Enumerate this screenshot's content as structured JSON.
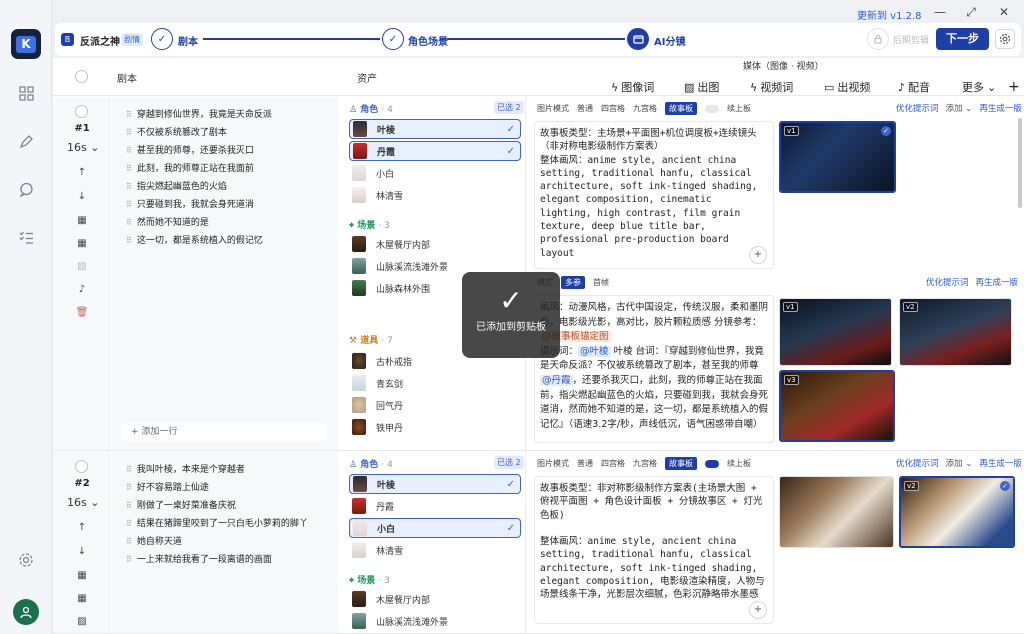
{
  "window": {
    "update_text": "更新到 v1.2.8"
  },
  "project": {
    "icon": "B",
    "name": "反派之神",
    "badge": "剧情"
  },
  "steps": [
    {
      "label": "剧本"
    },
    {
      "label": "角色场景"
    },
    {
      "label": "AI分镜"
    }
  ],
  "toolbar": {
    "post_edit": "后期剪辑",
    "next": "下一步"
  },
  "table": {
    "col_script": "剧本",
    "col_assets": "资产",
    "col_media": "媒体（图像 · 视频）",
    "tools": [
      "图像词",
      "出图",
      "视频词",
      "出视频",
      "配音",
      "更多"
    ]
  },
  "rows": [
    {
      "no": "#1",
      "duration": "16s",
      "lines": [
        "穿越到修仙世界，我竟是天命反派",
        "不仅被系统篡改了剧本",
        "甚至我的师尊，还要杀我灭口",
        "此刻，我的师尊正站在我面前",
        "指尖燃起幽蓝色的火焰",
        "只要碰到我，我就会身死道消",
        "然而她不知道的是",
        "这一切，都是系统植入的假记忆"
      ],
      "add_line": "添加一行",
      "roles_label": "角色",
      "roles_count": "· 4",
      "selected": "已选 2",
      "roles": [
        {
          "name": "叶棱",
          "sel": true
        },
        {
          "name": "丹霞",
          "sel": true
        },
        {
          "name": "小白",
          "sel": false
        },
        {
          "name": "林清雪",
          "sel": false
        }
      ],
      "scenes_label": "场景",
      "scenes_count": "· 3",
      "scenes": [
        "木屋餐厅内部",
        "山脉溪流浅滩外景",
        "山脉森林外围"
      ],
      "props_label": "道具",
      "props_count": "· 7",
      "props": [
        "古朴戒指",
        "青玄剑",
        "回气丹",
        "铁甲丹"
      ],
      "tabs1": [
        "图片模式",
        "普通",
        "四宫格",
        "九宫格",
        "故事板",
        "续上板"
      ],
      "links": [
        "优化提示词",
        "添加",
        "再生成一版"
      ],
      "prompt1": "故事板类型：主场景+平面图+机位调度板+连续镜头（非对称电影级制作方案表）\n整体画风：anime style, ancient china setting, traditional hanfu, classical architecture, soft ink-tinged shading, elegant composition, cinematic lighting, high contrast, film grain texture, deep blue title bar, professional pre-production board layout",
      "tabs2": [
        "模式",
        "多参",
        "首帧"
      ],
      "prompt2_a": "画风：动漫风格，古代中国设定，传统汉服，柔和墨阴影，电影级光影，高对比，胶片颗粒质感",
      "prompt2_tag1": "@故事板锚定图",
      "prompt2_b": "分镜参考：",
      "prompt2_c": "提示词：",
      "prompt2_tag2": "@叶棱",
      "prompt2_d": "叶棱 台词：『穿越到修仙世界，我竟是天命反派？不仅被系统篡改了剧本，甚至我的师尊",
      "prompt2_tag3": "@丹霞",
      "prompt2_e": "，还要杀我灭口，此刻，我的师尊正站在我面前，指尖燃起幽蓝色的火焰，只要碰到我，我就会身死道消，然而她不知道的是，这一切，都是系统植入的假记忆』（语速3.2字/秒，声线低沉，语气困惑带自嘲）"
    },
    {
      "no": "#2",
      "duration": "16s",
      "lines": [
        "我叫叶棱，本来是个穿越者",
        "好不容易踏上仙途",
        "刚做了一桌好菜准备庆祝",
        "结果在猪蹄里咬到了一只白毛小萝莉的脚丫",
        "她自称天道",
        "一上来就给我看了一段离谱的画面"
      ],
      "roles_label": "角色",
      "roles_count": "· 4",
      "selected": "已选 2",
      "roles": [
        {
          "name": "叶棱",
          "sel": true
        },
        {
          "name": "丹霞",
          "sel": false
        },
        {
          "name": "小白",
          "sel": true
        },
        {
          "name": "林清雪",
          "sel": false
        }
      ],
      "scenes_label": "场景",
      "scenes_count": "· 3",
      "scenes": [
        "木屋餐厅内部",
        "山脉溪流浅滩外景"
      ],
      "tabs1": [
        "图片模式",
        "普通",
        "四宫格",
        "九宫格",
        "故事板",
        "续上板"
      ],
      "links": [
        "优化提示词",
        "添加",
        "再生成一版"
      ],
      "prompt1": "故事板类型：非对称影级制作方案表(主场景大图 + 俯视平面图 + 角色设计面板 + 分镜故事区 + 灯光色板)\n\n整体画风：anime style, ancient china setting, traditional hanfu, classical architecture, soft ink-tinged shading, elegant composition, 电影级渲染精度，人物与场景线条干净，光影层次细腻，色彩沉静略带水墨感"
    }
  ],
  "toast": {
    "text": "已添加到剪贴板"
  },
  "versions": [
    "v1",
    "v1",
    "v2",
    "v3",
    "v2"
  ]
}
